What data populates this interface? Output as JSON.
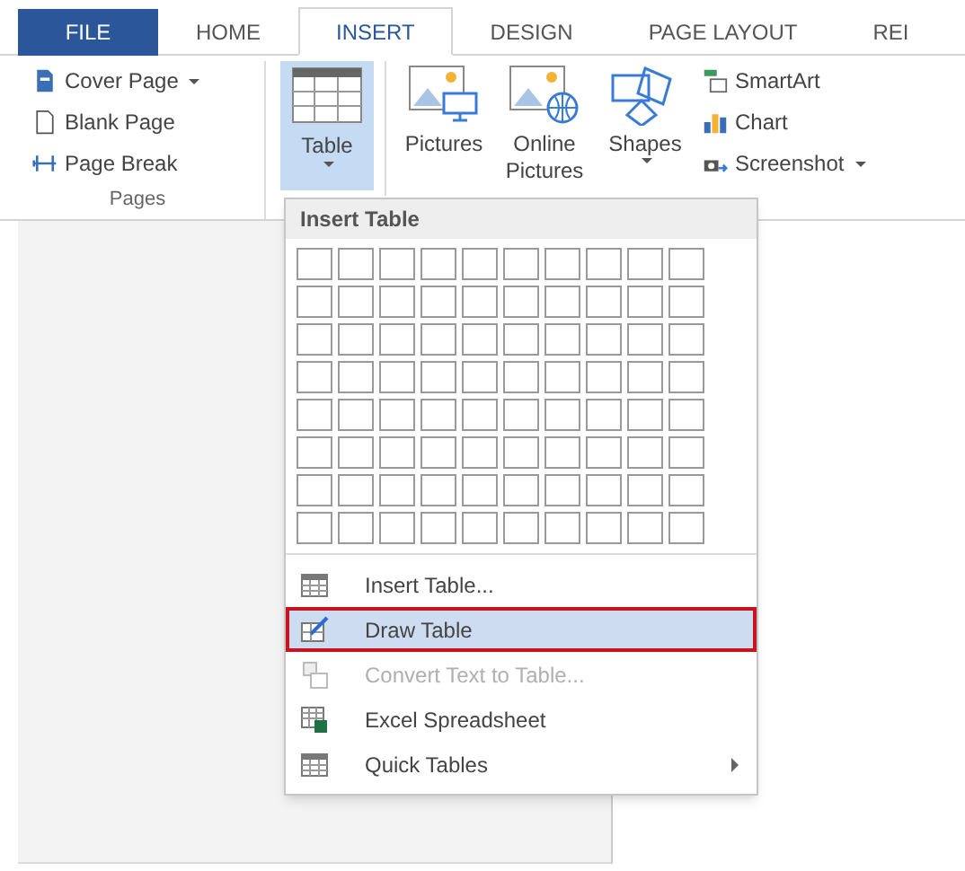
{
  "tabs": [
    {
      "label": "FILE",
      "kind": "file",
      "selected": false
    },
    {
      "label": "HOME",
      "kind": "tab",
      "selected": false
    },
    {
      "label": "INSERT",
      "kind": "tab",
      "selected": true
    },
    {
      "label": "DESIGN",
      "kind": "tab",
      "selected": false
    },
    {
      "label": "PAGE LAYOUT",
      "kind": "tab",
      "selected": false
    },
    {
      "label": "REI",
      "kind": "tab",
      "selected": false
    }
  ],
  "pages_group": {
    "label": "Pages",
    "items": [
      {
        "label": "Cover Page",
        "dropdown": true
      },
      {
        "label": "Blank Page",
        "dropdown": false
      },
      {
        "label": "Page Break",
        "dropdown": false
      }
    ]
  },
  "table_button": {
    "label": "Table",
    "expanded": true
  },
  "illustrations": [
    {
      "label": "Pictures",
      "dropdown": false
    },
    {
      "label": "Online Pictures",
      "dropdown": false
    },
    {
      "label": "Shapes",
      "dropdown": true
    }
  ],
  "small_buttons": [
    {
      "label": "SmartArt",
      "dropdown": false
    },
    {
      "label": "Chart",
      "dropdown": false
    },
    {
      "label": "Screenshot",
      "dropdown": true
    }
  ],
  "insert_table_menu": {
    "title": "Insert Table",
    "items": [
      {
        "label": "Insert Table...",
        "selected": false,
        "disabled": false,
        "submenu": false
      },
      {
        "label": "Draw Table",
        "selected": true,
        "disabled": false,
        "submenu": false
      },
      {
        "label": "Convert Text to Table...",
        "selected": false,
        "disabled": true,
        "submenu": false
      },
      {
        "label": "Excel Spreadsheet",
        "selected": false,
        "disabled": false,
        "submenu": false
      },
      {
        "label": "Quick Tables",
        "selected": false,
        "disabled": false,
        "submenu": true
      }
    ]
  }
}
